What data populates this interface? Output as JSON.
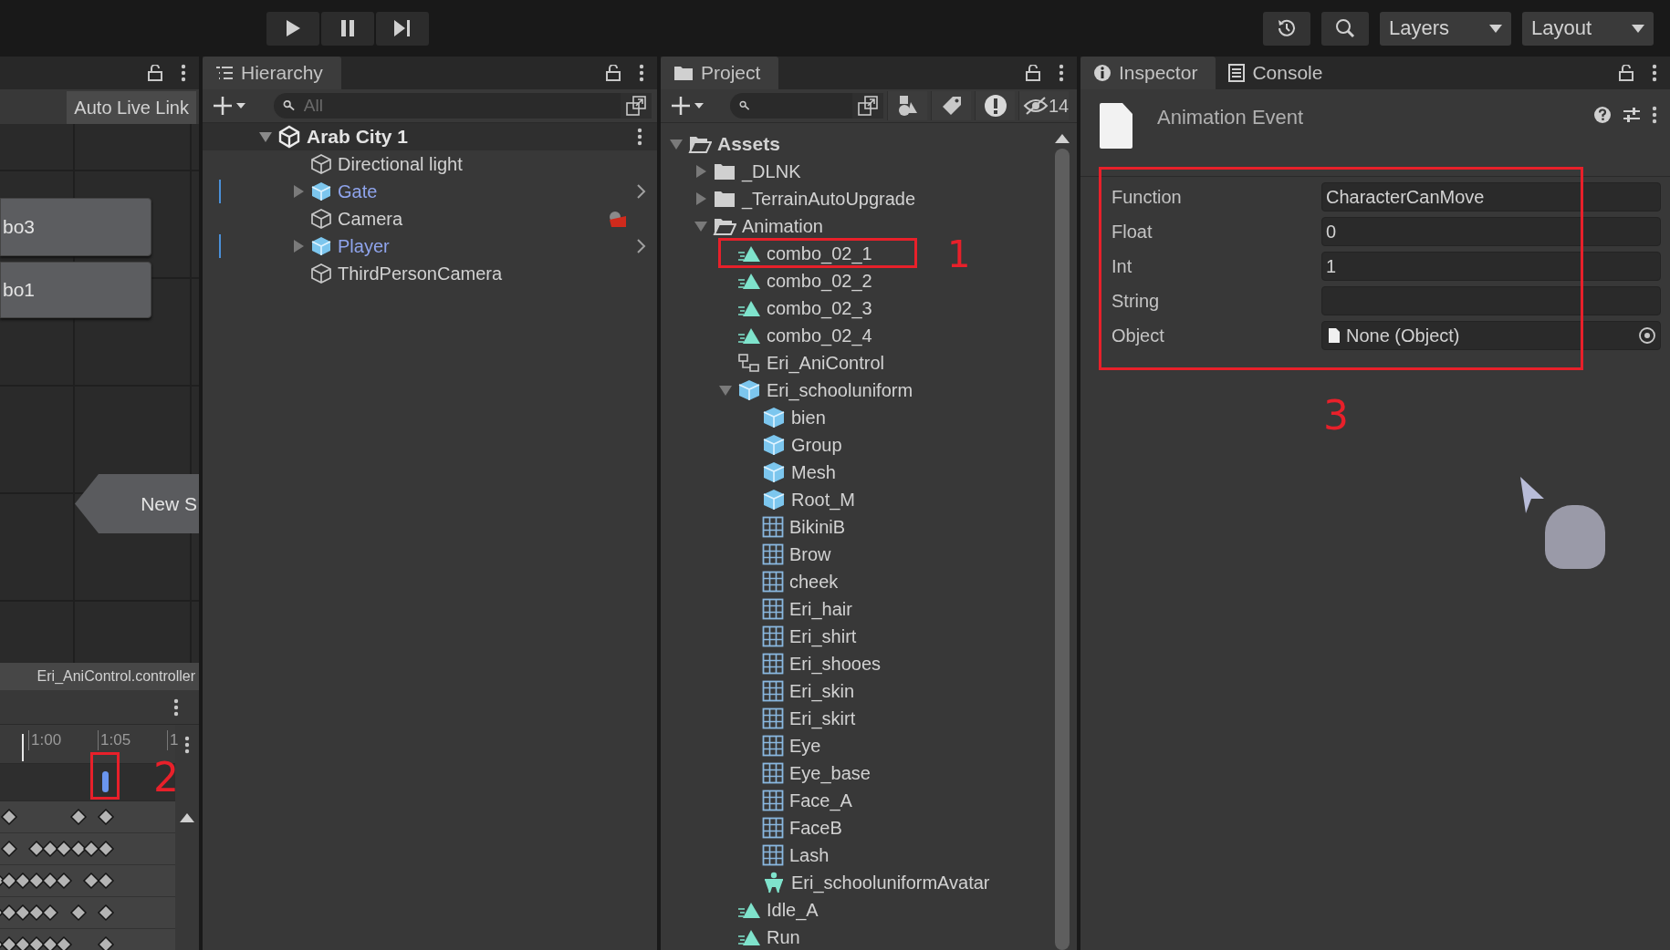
{
  "toolbar": {
    "playback": [
      {
        "kind": "play"
      },
      {
        "kind": "pause"
      },
      {
        "kind": "step"
      }
    ],
    "dropdowns": [
      {
        "label": "Layers"
      },
      {
        "label": "Layout"
      }
    ]
  },
  "animator": {
    "live_link_button": "Auto Live Link",
    "nodes": [
      {
        "label": "bo3",
        "kind": "state"
      },
      {
        "label": "bo1",
        "kind": "state"
      },
      {
        "label": "New S",
        "kind": "entry"
      }
    ],
    "controller_path": "Eri_AniControl.controller"
  },
  "animation": {
    "ruler": [
      "1:00",
      "1:05",
      "1"
    ],
    "event": {
      "callout": "2"
    }
  },
  "hierarchy": {
    "tab": "Hierarchy",
    "search": {
      "placeholder": "All"
    },
    "scene": {
      "label": "Arab City 1",
      "expanded": true
    },
    "items": [
      {
        "label": "Directional light",
        "kind": "object"
      },
      {
        "label": "Gate",
        "kind": "prefab",
        "expanded": false
      },
      {
        "label": "Camera",
        "kind": "camera"
      },
      {
        "label": "Player",
        "kind": "prefab",
        "expanded": false
      },
      {
        "label": "ThirdPersonCamera",
        "kind": "object"
      }
    ]
  },
  "project": {
    "tab": "Project",
    "hidden_count": "14",
    "tree": [
      {
        "label": "Assets",
        "kind": "folder",
        "expanded": true,
        "children": [
          {
            "label": "_DLNK",
            "kind": "folder",
            "expanded": false
          },
          {
            "label": "_TerrainAutoUpgrade",
            "kind": "folder",
            "expanded": false
          },
          {
            "label": "Animation",
            "kind": "folder",
            "expanded": true,
            "children": [
              {
                "label": "combo_02_1",
                "kind": "anim",
                "callout": "1"
              },
              {
                "label": "combo_02_2",
                "kind": "anim"
              },
              {
                "label": "combo_02_3",
                "kind": "anim"
              },
              {
                "label": "combo_02_4",
                "kind": "anim"
              },
              {
                "label": "Eri_AniControl",
                "kind": "controller"
              },
              {
                "label": "Eri_schooluniform",
                "kind": "model",
                "expanded": true,
                "children": [
                  {
                    "label": "bien",
                    "kind": "model"
                  },
                  {
                    "label": "Group",
                    "kind": "model"
                  },
                  {
                    "label": "Mesh",
                    "kind": "model"
                  },
                  {
                    "label": "Root_M",
                    "kind": "model"
                  },
                  {
                    "label": "BikiniB",
                    "kind": "mesh"
                  },
                  {
                    "label": "Brow",
                    "kind": "mesh"
                  },
                  {
                    "label": "cheek",
                    "kind": "mesh"
                  },
                  {
                    "label": "Eri_hair",
                    "kind": "mesh"
                  },
                  {
                    "label": "Eri_shirt",
                    "kind": "mesh"
                  },
                  {
                    "label": "Eri_shooes",
                    "kind": "mesh"
                  },
                  {
                    "label": "Eri_skin",
                    "kind": "mesh"
                  },
                  {
                    "label": "Eri_skirt",
                    "kind": "mesh"
                  },
                  {
                    "label": "Eye",
                    "kind": "mesh"
                  },
                  {
                    "label": "Eye_base",
                    "kind": "mesh"
                  },
                  {
                    "label": "Face_A",
                    "kind": "mesh"
                  },
                  {
                    "label": "FaceB",
                    "kind": "mesh"
                  },
                  {
                    "label": "Lash",
                    "kind": "mesh"
                  },
                  {
                    "label": "Eri_schooluniformAvatar",
                    "kind": "avatar"
                  }
                ]
              },
              {
                "label": "Idle_A",
                "kind": "anim"
              },
              {
                "label": "Run",
                "kind": "anim"
              }
            ]
          }
        ]
      }
    ]
  },
  "inspector": {
    "tabs": [
      {
        "label": "Inspector",
        "kind": "info",
        "selected": true
      },
      {
        "label": "Console",
        "kind": "console",
        "selected": false
      }
    ],
    "title": "Animation Event",
    "callout": "3",
    "fields": [
      {
        "label": "Function",
        "kind": "text",
        "value": "CharacterCanMove"
      },
      {
        "label": "Float",
        "kind": "text",
        "value": "0"
      },
      {
        "label": "Int",
        "kind": "text",
        "value": "1"
      },
      {
        "label": "String",
        "kind": "text"
      },
      {
        "label": "Object",
        "kind": "object",
        "value": "None (Object)"
      }
    ]
  }
}
